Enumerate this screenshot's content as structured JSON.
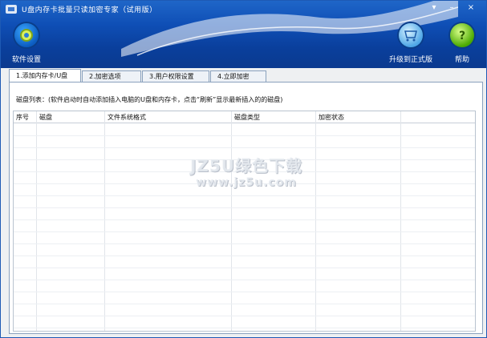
{
  "window": {
    "title": "U盘内存卡批量只读加密专家（试用版）",
    "controls": {
      "menu": "▾",
      "minimize": "–",
      "close": "×"
    }
  },
  "toolbar": {
    "settings_label": "软件设置",
    "upgrade_label": "升级到正式版",
    "help_label": "帮助"
  },
  "tabs": [
    {
      "label": "1.添加内存卡/U盘",
      "active": true
    },
    {
      "label": "2.加密选项",
      "active": false
    },
    {
      "label": "3.用户权限设置",
      "active": false
    },
    {
      "label": "4.立即加密",
      "active": false
    }
  ],
  "panel": {
    "hint": "磁盘列表：(软件启动时自动添加插入电脑的U盘和内存卡，点击“刷新”显示最新插入的的磁盘)",
    "columns": [
      "序号",
      "磁盘",
      "文件系统格式",
      "磁盘类型",
      "加密状态"
    ]
  },
  "watermark": {
    "line1": "JZ5U绿色下载",
    "line2": "www.jz5u.com"
  },
  "colors": {
    "header_top": "#1f66c8",
    "header_bottom": "#0b3a8f",
    "border": "#8aa1bd"
  }
}
